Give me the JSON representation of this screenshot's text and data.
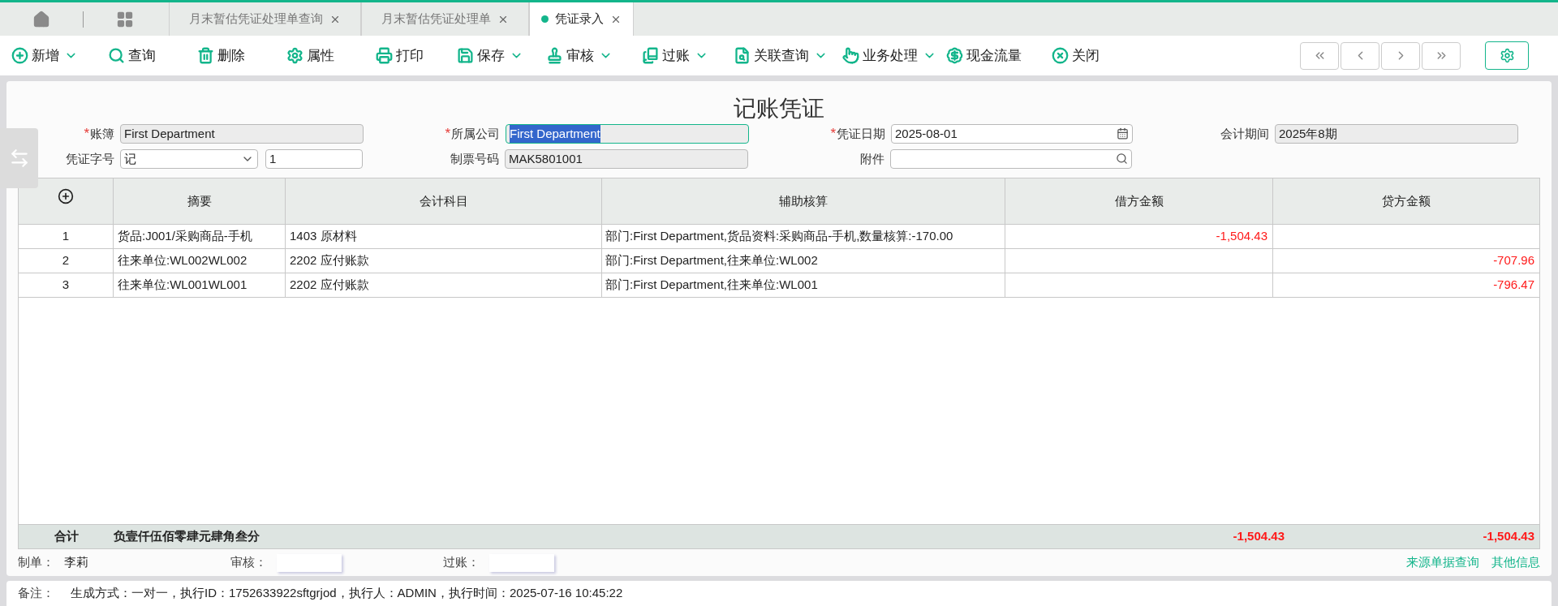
{
  "tabs": [
    {
      "label": "月末暂估凭证处理单查询",
      "selected": false
    },
    {
      "label": "月末暂估凭证处理单",
      "selected": false
    },
    {
      "label": "凭证录入",
      "selected": true
    }
  ],
  "toolbar": [
    {
      "label": "新增",
      "has_menu": true
    },
    {
      "label": "查询",
      "has_menu": false
    },
    {
      "label": "删除",
      "has_menu": false
    },
    {
      "label": "属性",
      "has_menu": false
    },
    {
      "label": "打印",
      "has_menu": false
    },
    {
      "label": "保存",
      "has_menu": true
    },
    {
      "label": "审核",
      "has_menu": true
    },
    {
      "label": "过账",
      "has_menu": true
    },
    {
      "label": "关联查询",
      "has_menu": true
    },
    {
      "label": "业务处理",
      "has_menu": true
    },
    {
      "label": "现金流量",
      "has_menu": false
    },
    {
      "label": "关闭",
      "has_menu": false
    }
  ],
  "title": "记账凭证",
  "required_mark": "*",
  "form": [
    [
      {
        "label": "账簿",
        "required": true,
        "kind": "readonly",
        "value": "First Department",
        "focused": false
      },
      {
        "label": "所属公司",
        "required": true,
        "kind": "readonly",
        "value": "First Department",
        "focused": true
      },
      {
        "label": "凭证日期",
        "required": true,
        "kind": "date",
        "value": "2025-08-01",
        "focused": false
      },
      {
        "label": "会计期间",
        "required": false,
        "kind": "readonly",
        "value": "2025年8期",
        "focused": false
      }
    ],
    [
      {
        "label": "凭证字号",
        "required": false,
        "kind": "select_pair",
        "value": "记",
        "number": "1",
        "focused": false
      },
      {
        "label": "制票号码",
        "required": false,
        "kind": "readonly",
        "value": "MAK5801001",
        "focused": false
      },
      {
        "label": "附件",
        "required": false,
        "kind": "lookup",
        "focused": false
      }
    ]
  ],
  "table": {
    "columns": [
      "摘要",
      "会计科目",
      "辅助核算",
      "借方金额",
      "贷方金额"
    ],
    "rows": [
      {
        "index": "1",
        "summary": "货品:J001/采购商品-手机",
        "account": "1403 原材料",
        "auxiliary": "部门:First Department,货品资料:采购商品-手机,数量核算:-170.00",
        "debit": "-1,504.43"
      },
      {
        "index": "2",
        "summary": "往来单位:WL002WL002",
        "account": "2202 应付账款",
        "auxiliary": "部门:First Department,往来单位:WL002",
        "credit": "-707.96"
      },
      {
        "index": "3",
        "summary": "往来单位:WL001WL001",
        "account": "2202 应付账款",
        "auxiliary": "部门:First Department,往来单位:WL001",
        "credit": "-796.47"
      }
    ],
    "total": {
      "label": "合计",
      "amount_in_words": "负壹仟伍佰零肆元肆角叁分",
      "debit": "-1,504.43",
      "credit": "-1,504.43"
    }
  },
  "signatures": [
    {
      "label": "制单：",
      "value": "李莉"
    },
    {
      "label": "审核："
    },
    {
      "label": "过账："
    }
  ],
  "links": [
    "来源单据查询",
    "其他信息"
  ],
  "remarks": {
    "label": "备注：",
    "text": "生成方式：一对一，执行ID：1752633922sftgrjod，执行人：ADMIN，执行时间：2025-07-16 10:45:22"
  }
}
